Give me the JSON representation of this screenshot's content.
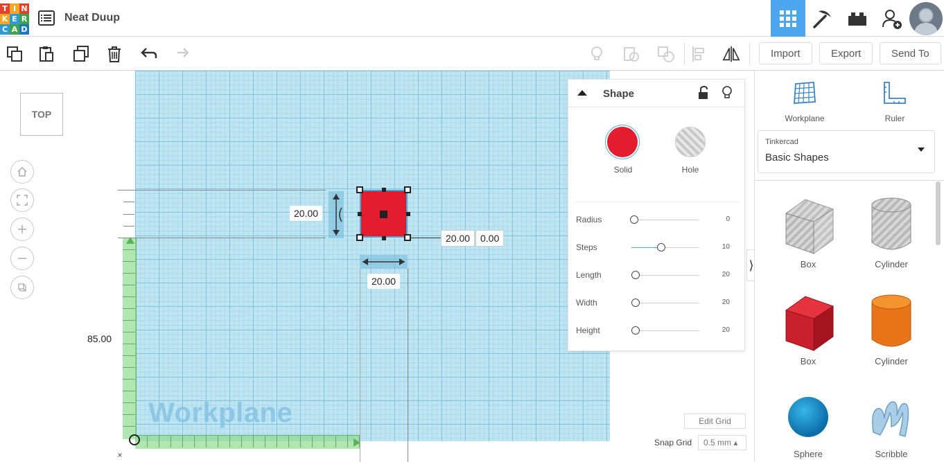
{
  "app": {
    "logo_letters": [
      "T",
      "I",
      "N",
      "K",
      "E",
      "R",
      "C",
      "A",
      "D"
    ],
    "logo_colors": [
      "#e2412e",
      "#f5a623",
      "#e2412e",
      "#f5a623",
      "#2e9bd6",
      "#3ea34a",
      "#2e9bd6",
      "#3ea34a",
      "#1f77c0"
    ],
    "project_title": "Neat Duup",
    "accent": "#4da6ee"
  },
  "toolbar": {
    "import_label": "Import",
    "export_label": "Export",
    "send_to_label": "Send To"
  },
  "viewcube": {
    "face": "TOP"
  },
  "canvas": {
    "workplane_label": "Workplane",
    "height_dim": "20.00",
    "width_dim": "20.00",
    "length_dim": "20.00",
    "elevation_dim": "0.00",
    "y_offset_dim": "85.00",
    "edit_grid_label": "Edit Grid",
    "snap_grid_label": "Snap Grid",
    "snap_grid_value": "0.5 mm ▴",
    "close_label": "×",
    "shape_color": "#e31d2e"
  },
  "inspector": {
    "title": "Shape",
    "solid_label": "Solid",
    "hole_label": "Hole",
    "props": [
      {
        "label": "Radius",
        "value": "0",
        "level": 0
      },
      {
        "label": "Steps",
        "value": "10",
        "level": 0.4
      },
      {
        "label": "Length",
        "value": "20",
        "level": 0.02
      },
      {
        "label": "Width",
        "value": "20",
        "level": 0.02
      },
      {
        "label": "Height",
        "value": "20",
        "level": 0.02
      }
    ]
  },
  "right_panel": {
    "workplane_label": "Workplane",
    "ruler_label": "Ruler",
    "library_provider": "Tinkercad",
    "library_name": "Basic Shapes",
    "shapes": [
      {
        "label": "Box"
      },
      {
        "label": "Cylinder"
      },
      {
        "label": "Box"
      },
      {
        "label": "Cylinder"
      },
      {
        "label": "Sphere"
      },
      {
        "label": "Scribble"
      }
    ]
  }
}
